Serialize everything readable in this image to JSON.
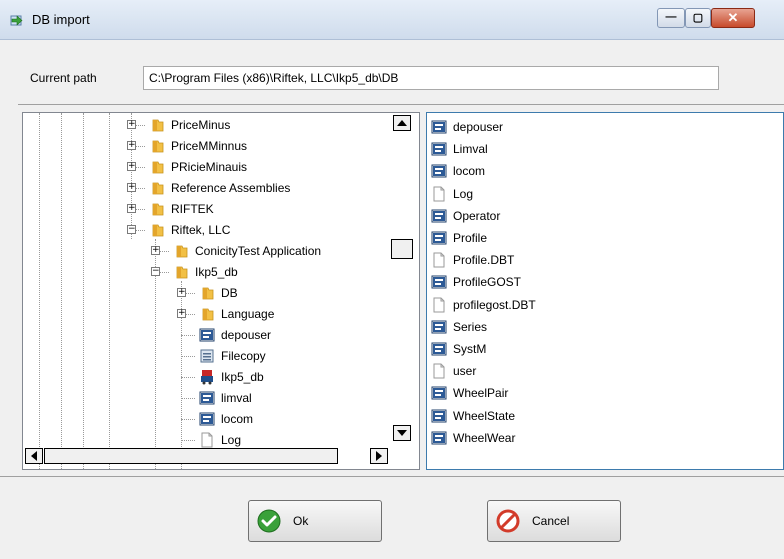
{
  "window": {
    "title": "DB import",
    "close_glyph": "✕",
    "min_glyph": "—",
    "max_glyph": "▢"
  },
  "path": {
    "label": "Current path",
    "value": "C:\\Program Files (x86)\\Riftek, LLC\\Ikp5_db\\DB"
  },
  "tree": {
    "items": [
      {
        "label": "PriceMinus",
        "icon": "folder-icon",
        "expander": "+"
      },
      {
        "label": "PriceMMinnus",
        "icon": "folder-icon",
        "expander": "+"
      },
      {
        "label": "PRicieMinauis",
        "icon": "folder-icon",
        "expander": "+"
      },
      {
        "label": "Reference Assemblies",
        "icon": "folder-icon",
        "expander": "+"
      },
      {
        "label": "RIFTEK",
        "icon": "folder-icon",
        "expander": "+"
      },
      {
        "label": "Riftek, LLC",
        "icon": "folder-open-icon",
        "expander": "−"
      },
      {
        "label": "ConicityTest Application",
        "icon": "folder-icon",
        "expander": "+"
      },
      {
        "label": "Ikp5_db",
        "icon": "folder-open-icon",
        "expander": "−"
      },
      {
        "label": "DB",
        "icon": "folder-icon",
        "expander": "+"
      },
      {
        "label": "Language",
        "icon": "folder-icon",
        "expander": "+"
      },
      {
        "label": "depouser",
        "icon": "table-icon"
      },
      {
        "label": "Filecopy",
        "icon": "executable-icon"
      },
      {
        "label": "Ikp5_db",
        "icon": "app-icon"
      },
      {
        "label": "limval",
        "icon": "table-icon"
      },
      {
        "label": "locom",
        "icon": "table-icon"
      },
      {
        "label": "Log",
        "icon": "document-icon"
      }
    ]
  },
  "files": {
    "items": [
      {
        "label": "depouser",
        "icon": "table-icon"
      },
      {
        "label": "Limval",
        "icon": "table-icon"
      },
      {
        "label": "locom",
        "icon": "table-icon"
      },
      {
        "label": "Log",
        "icon": "document-icon"
      },
      {
        "label": "Operator",
        "icon": "table-icon"
      },
      {
        "label": "Profile",
        "icon": "table-icon"
      },
      {
        "label": "Profile.DBT",
        "icon": "document-icon"
      },
      {
        "label": "ProfileGOST",
        "icon": "table-icon"
      },
      {
        "label": "profilegost.DBT",
        "icon": "document-icon"
      },
      {
        "label": "Series",
        "icon": "table-icon"
      },
      {
        "label": "SystM",
        "icon": "table-icon"
      },
      {
        "label": "user",
        "icon": "document-icon"
      },
      {
        "label": "WheelPair",
        "icon": "table-icon"
      },
      {
        "label": "WheelState",
        "icon": "table-icon"
      },
      {
        "label": "WheelWear",
        "icon": "table-icon"
      }
    ]
  },
  "buttons": {
    "ok": "Ok",
    "cancel": "Cancel"
  },
  "colors": {
    "selection_border": "#3d7bad",
    "folder": "#f2c045",
    "ok_green": "#3aa13a",
    "cancel_red": "#d23b2a"
  }
}
